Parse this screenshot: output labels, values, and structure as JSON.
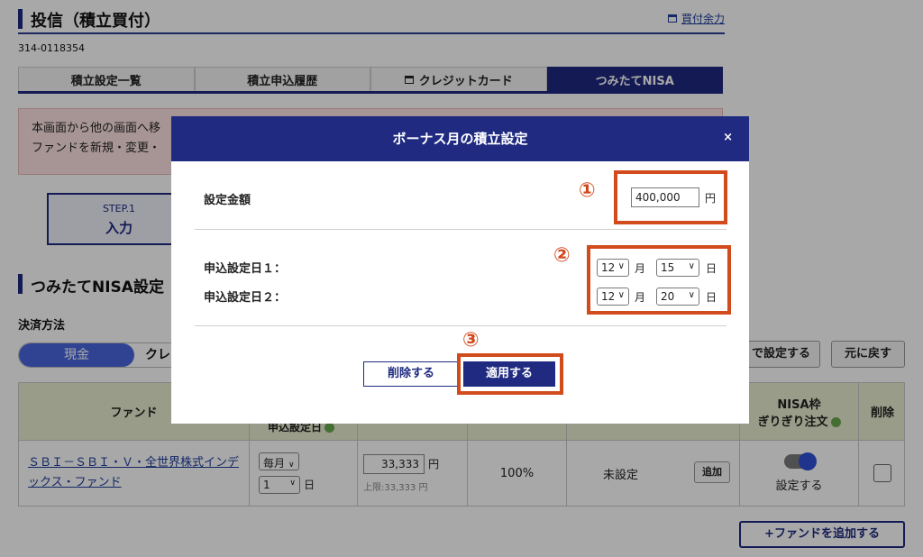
{
  "header": {
    "title": "投信（積立買付）",
    "buying_power_link": "買付余力",
    "account_number": "314-0118354"
  },
  "tabs": [
    {
      "label": "積立設定一覧",
      "active": false
    },
    {
      "label": "積立申込履歴",
      "active": false
    },
    {
      "label": "クレジットカード",
      "active": false
    },
    {
      "label": "つみたてNISA",
      "active": true
    }
  ],
  "notice": {
    "line1": "本画面から他の画面へ移",
    "line2": "ファンドを新規・変更・"
  },
  "step": {
    "label": "STEP.1",
    "title": "入力"
  },
  "section_title": "つみたてNISA設定",
  "payment": {
    "label": "決済方法",
    "option_selected": "現金",
    "option_other": "クレ"
  },
  "actions": {
    "setting_button": "で設定する",
    "reset_button": "元に戻す",
    "add_fund_button": "+ファンドを追加する"
  },
  "table": {
    "headers": {
      "fund": "ファンド",
      "date_partial": "申込設定日",
      "nisa_line1": "NISA枠",
      "nisa_line2": "ぎりぎり注文",
      "delete": "削除"
    },
    "row": {
      "fund_name": "ＳＢＩ－ＳＢＩ・Ｖ・全世界株式インデックス・ファンド",
      "frequency": "毎月",
      "day": "1",
      "day_unit": "日",
      "amount": "33,333",
      "amount_unit": "円",
      "limit": "上限:33,333 円",
      "ratio": "100%",
      "bonus_status": "未設定",
      "add_button": "追加",
      "nisa_toggle_label": "設定する"
    }
  },
  "modal": {
    "title": "ボーナス月の積立設定",
    "close_label": "×",
    "amount_label": "設定金額",
    "amount_value": "400,000",
    "amount_unit": "円",
    "date1_label": "申込設定日１：",
    "date2_label": "申込設定日２：",
    "date1_month": "12",
    "date1_day": "15",
    "date2_month": "12",
    "date2_day": "20",
    "month_unit": "月",
    "day_unit": "日",
    "delete_button": "削除する",
    "apply_button": "適用する",
    "annotations": [
      "①",
      "②",
      "③"
    ]
  },
  "colors": {
    "brand_navy": "#1f2a80",
    "annotation_red": "#d24b1c",
    "toggle_blue": "#4a67e0"
  }
}
